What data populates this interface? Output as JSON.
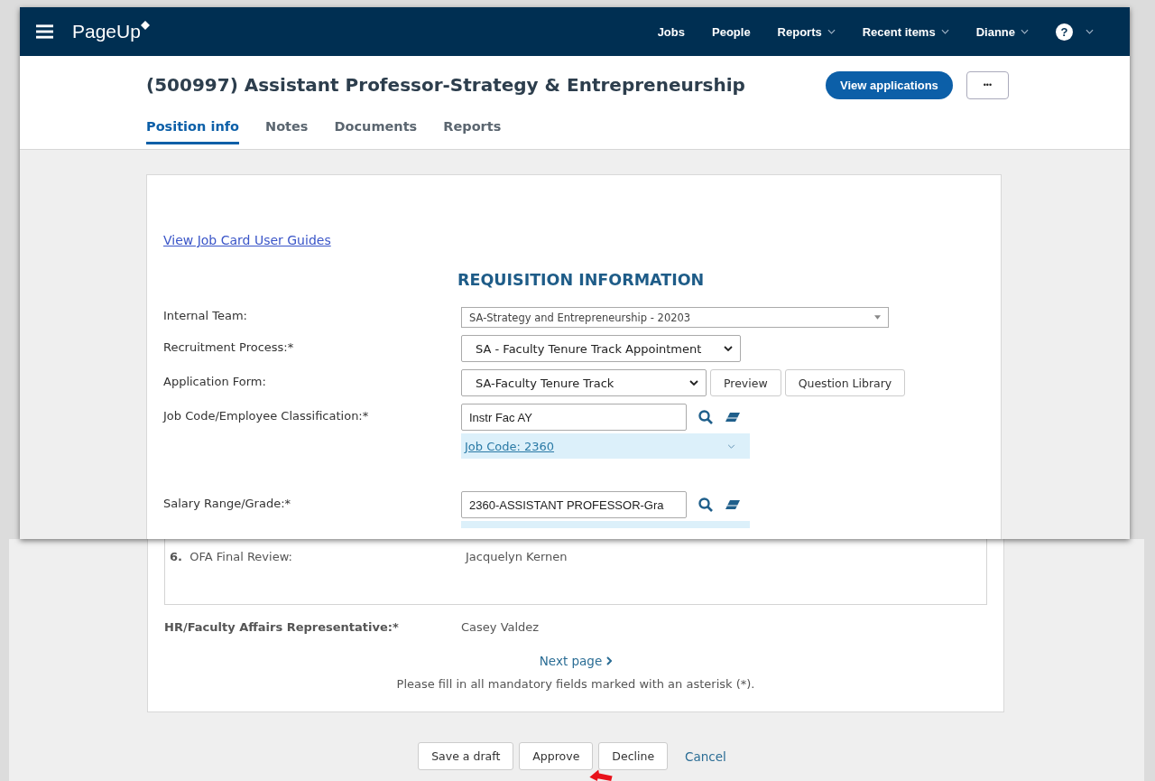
{
  "navbar": {
    "logo": "PageUp",
    "items": [
      {
        "label": "Jobs",
        "dropdown": false
      },
      {
        "label": "People",
        "dropdown": false
      },
      {
        "label": "Reports",
        "dropdown": true
      },
      {
        "label": "Recent items",
        "dropdown": true
      },
      {
        "label": "Dianne",
        "dropdown": true
      }
    ],
    "help": "?"
  },
  "header": {
    "title": "(500997) Assistant Professor-Strategy & Entrepreneurship",
    "primary_button": "View applications",
    "more_button": "•••"
  },
  "tabs": [
    {
      "label": "Position info",
      "selected": true
    },
    {
      "label": "Notes",
      "selected": false
    },
    {
      "label": "Documents",
      "selected": false
    },
    {
      "label": "Reports",
      "selected": false
    }
  ],
  "form": {
    "guide_link": "View Job Card User Guides",
    "section_title": "REQUISITION INFORMATION",
    "fields": [
      {
        "kind": "combo",
        "label": "Internal Team:",
        "value": "SA-Strategy and Entrepreneurship - 20203"
      },
      {
        "kind": "select",
        "label": "Recruitment Process:*",
        "value": "SA - Faculty Tenure Track Appointment"
      },
      {
        "kind": "select",
        "label": "Application Form:",
        "value": "SA-Faculty Tenure Track",
        "buttons": [
          "Preview",
          "Question Library"
        ]
      },
      {
        "kind": "lookup",
        "label": "Job Code/Employee Classification:*",
        "value": "Instr Fac AY",
        "result": "Job Code: 2360"
      },
      {
        "kind": "lookup",
        "label": "Salary Range/Grade:*",
        "value": "2360-ASSISTANT PROFESSOR-Gra"
      }
    ]
  },
  "approvers": [
    {
      "number": "6.",
      "step": "OFA Final Review:",
      "name": "Jacquelyn Kernen"
    }
  ],
  "representative": {
    "label": "HR/Faculty Affairs Representative:*",
    "value": "Casey Valdez"
  },
  "next_page": "Next page",
  "note": "Please fill in all mandatory fields marked with an asterisk (*).",
  "actions": [
    {
      "kind": "button",
      "label": "Save a draft"
    },
    {
      "kind": "button",
      "label": "Approve"
    },
    {
      "kind": "button",
      "label": "Decline"
    },
    {
      "kind": "link",
      "label": "Cancel"
    }
  ]
}
